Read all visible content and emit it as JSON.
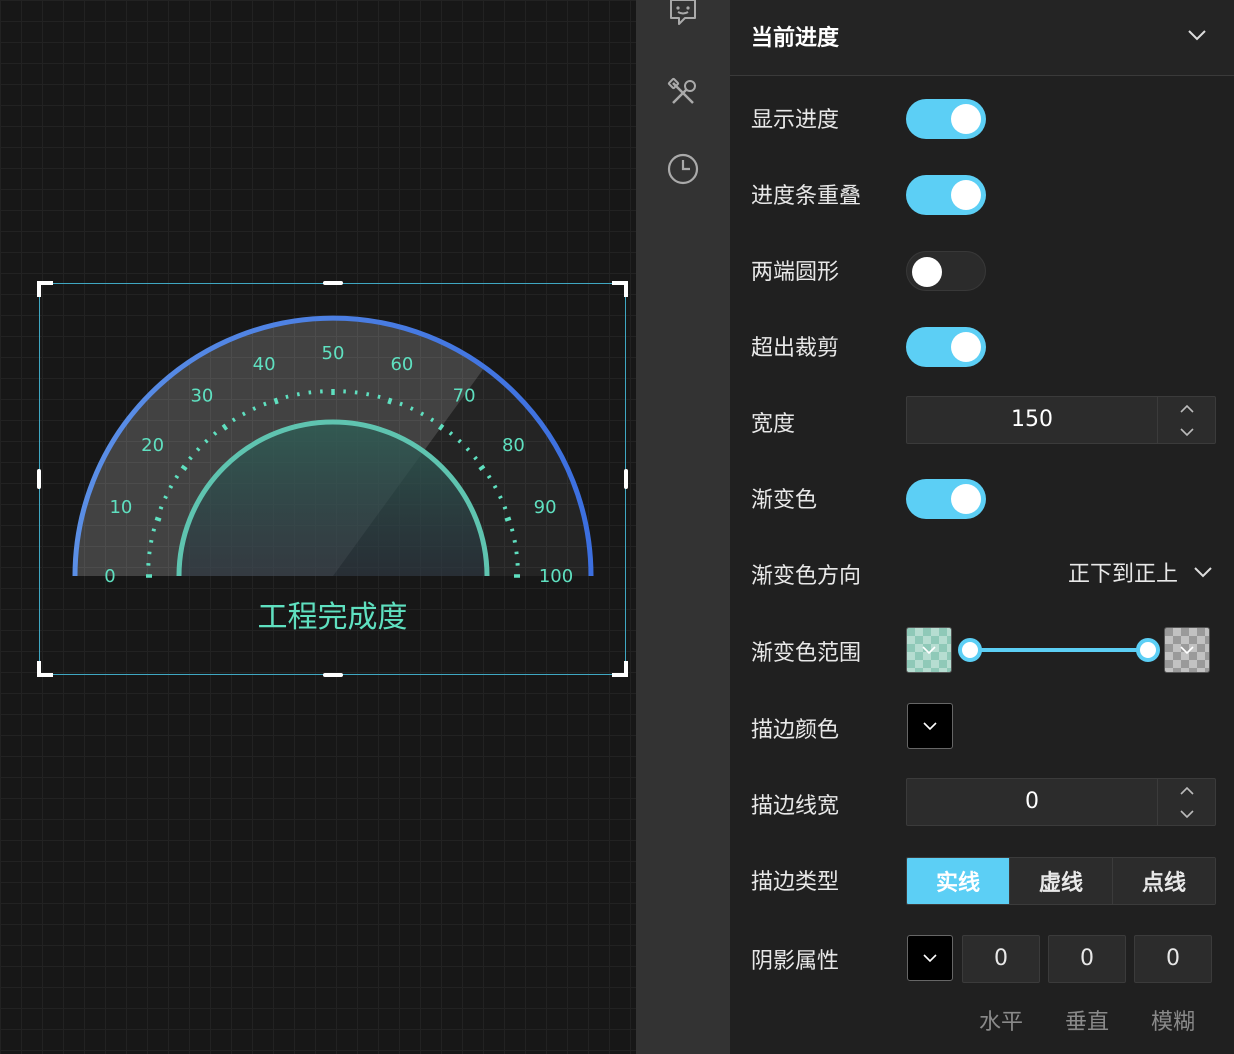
{
  "gauge": {
    "title": "工程完成度",
    "scale_labels": [
      "0",
      "10",
      "20",
      "30",
      "40",
      "50",
      "60",
      "70",
      "80",
      "90",
      "100"
    ],
    "range": [
      0,
      100
    ],
    "progress_value": 70,
    "colors": {
      "outer_arc": "#4f86e8",
      "inner_arc": "#5fc4b0",
      "ticks": "#5fe0c0",
      "labels": "#5fe0c0"
    }
  },
  "panel": {
    "header_title": "当前进度",
    "rows": {
      "show_progress": {
        "label": "显示进度",
        "on": true
      },
      "progress_overlap": {
        "label": "进度条重叠",
        "on": true
      },
      "round_caps": {
        "label": "两端圆形",
        "on": false
      },
      "overflow_clip": {
        "label": "超出裁剪",
        "on": true
      },
      "width": {
        "label": "宽度",
        "value": "150"
      },
      "gradient": {
        "label": "渐变色",
        "on": true
      },
      "gradient_direction": {
        "label": "渐变色方向",
        "value": "正下到正上"
      },
      "gradient_range": {
        "label": "渐变色范围",
        "start": 0,
        "end": 1
      },
      "stroke_color": {
        "label": "描边颜色",
        "value": "#000000"
      },
      "stroke_width": {
        "label": "描边线宽",
        "value": "0"
      },
      "stroke_type": {
        "label": "描边类型",
        "options": [
          "实线",
          "虚线",
          "点线"
        ],
        "selected": 0
      },
      "shadow": {
        "label": "阴影属性",
        "color": "#000000",
        "values": [
          "0",
          "0",
          "0"
        ],
        "captions": [
          "水平",
          "垂直",
          "模糊"
        ]
      }
    }
  },
  "toolstrip": {
    "icons": [
      "comment-icon",
      "tools-icon",
      "history-icon"
    ]
  },
  "colors": {
    "accent": "#5ccff5"
  }
}
